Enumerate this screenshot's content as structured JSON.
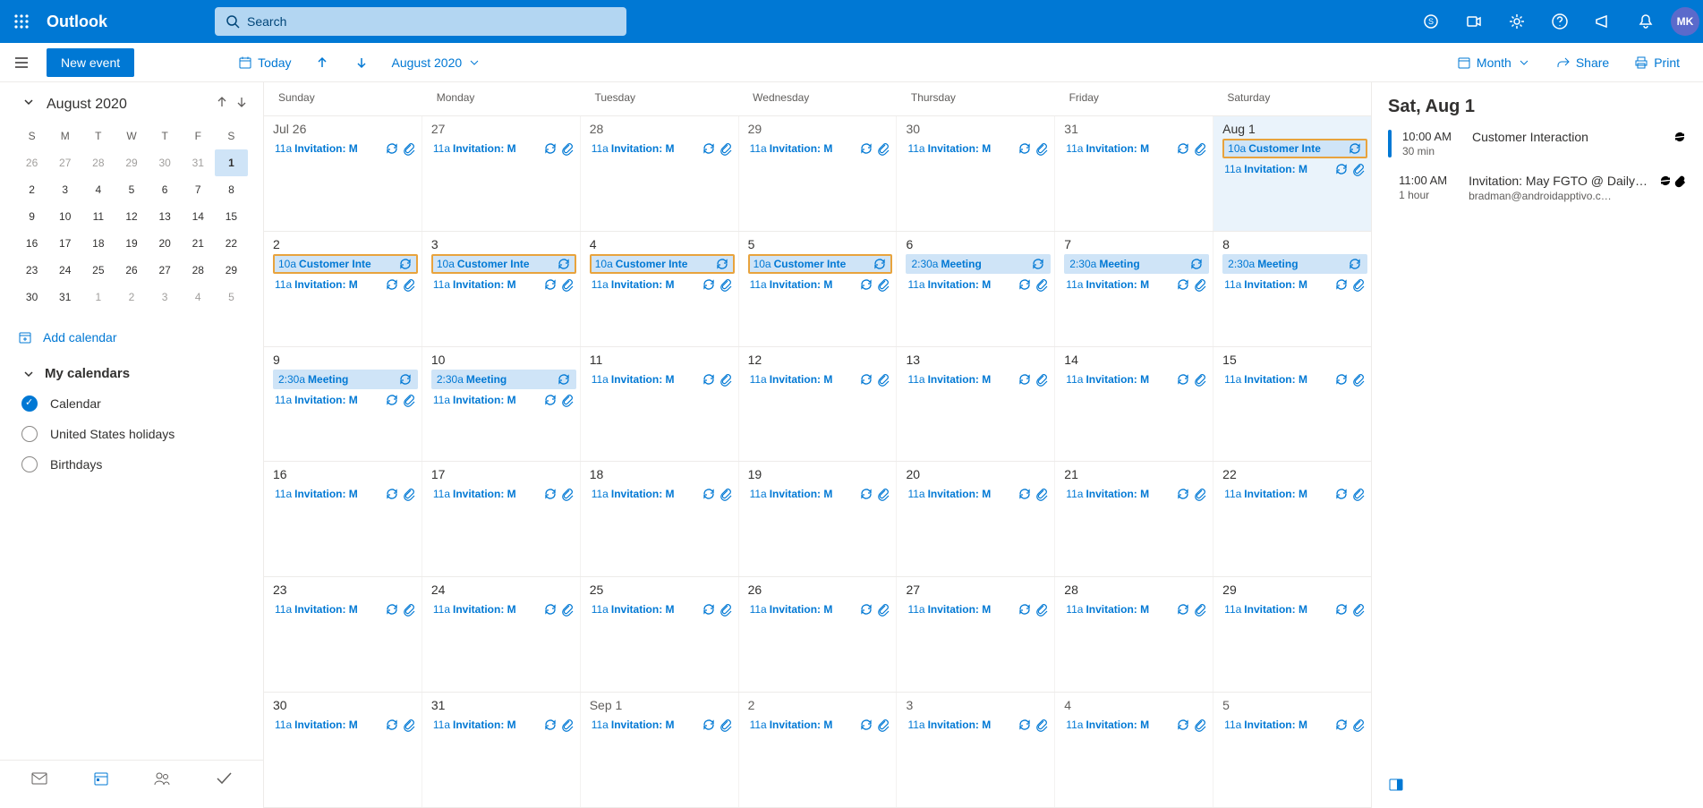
{
  "header": {
    "brand": "Outlook",
    "search_placeholder": "Search",
    "avatar_initials": "MK"
  },
  "toolbar": {
    "new_event": "New event",
    "today": "Today",
    "month_label": "August 2020",
    "view_label": "Month",
    "share": "Share",
    "print": "Print"
  },
  "miniCal": {
    "title": "August 2020",
    "dows": [
      "S",
      "M",
      "T",
      "W",
      "T",
      "F",
      "S"
    ],
    "rows": [
      [
        {
          "n": "26",
          "o": true
        },
        {
          "n": "27",
          "o": true
        },
        {
          "n": "28",
          "o": true
        },
        {
          "n": "29",
          "o": true
        },
        {
          "n": "30",
          "o": true
        },
        {
          "n": "31",
          "o": true
        },
        {
          "n": "1",
          "sel": true
        }
      ],
      [
        {
          "n": "2"
        },
        {
          "n": "3"
        },
        {
          "n": "4"
        },
        {
          "n": "5"
        },
        {
          "n": "6"
        },
        {
          "n": "7"
        },
        {
          "n": "8"
        }
      ],
      [
        {
          "n": "9"
        },
        {
          "n": "10"
        },
        {
          "n": "11"
        },
        {
          "n": "12"
        },
        {
          "n": "13"
        },
        {
          "n": "14"
        },
        {
          "n": "15"
        }
      ],
      [
        {
          "n": "16"
        },
        {
          "n": "17"
        },
        {
          "n": "18"
        },
        {
          "n": "19"
        },
        {
          "n": "20"
        },
        {
          "n": "21"
        },
        {
          "n": "22"
        }
      ],
      [
        {
          "n": "23"
        },
        {
          "n": "24"
        },
        {
          "n": "25"
        },
        {
          "n": "26"
        },
        {
          "n": "27"
        },
        {
          "n": "28"
        },
        {
          "n": "29"
        }
      ],
      [
        {
          "n": "30"
        },
        {
          "n": "31"
        },
        {
          "n": "1",
          "o": true
        },
        {
          "n": "2",
          "o": true
        },
        {
          "n": "3",
          "o": true
        },
        {
          "n": "4",
          "o": true
        },
        {
          "n": "5",
          "o": true
        }
      ]
    ]
  },
  "sidebar": {
    "add_calendar": "Add calendar",
    "my_calendars": "My calendars",
    "calendars": [
      {
        "name": "Calendar",
        "on": true
      },
      {
        "name": "United States holidays",
        "on": false
      },
      {
        "name": "Birthdays",
        "on": false
      }
    ]
  },
  "grid": {
    "dows": [
      "Sunday",
      "Monday",
      "Tuesday",
      "Wednesday",
      "Thursday",
      "Friday",
      "Saturday"
    ],
    "weeks": [
      [
        {
          "label": "Jul 26",
          "out": true,
          "events": [
            {
              "t": "11a",
              "title": "Invitation: M",
              "rec": true,
              "att": true
            }
          ]
        },
        {
          "label": "27",
          "out": true,
          "events": [
            {
              "t": "11a",
              "title": "Invitation: M",
              "rec": true,
              "att": true
            }
          ]
        },
        {
          "label": "28",
          "out": true,
          "events": [
            {
              "t": "11a",
              "title": "Invitation: M",
              "rec": true,
              "att": true
            }
          ]
        },
        {
          "label": "29",
          "out": true,
          "events": [
            {
              "t": "11a",
              "title": "Invitation: M",
              "rec": true,
              "att": true
            }
          ]
        },
        {
          "label": "30",
          "out": true,
          "events": [
            {
              "t": "11a",
              "title": "Invitation: M",
              "rec": true,
              "att": true
            }
          ]
        },
        {
          "label": "31",
          "out": true,
          "events": [
            {
              "t": "11a",
              "title": "Invitation: M",
              "rec": true,
              "att": true
            }
          ]
        },
        {
          "label": "Aug 1",
          "today": true,
          "events": [
            {
              "t": "10a",
              "title": "Customer Inte",
              "rec": true,
              "boxed": true
            },
            {
              "t": "11a",
              "title": "Invitation: M",
              "rec": true,
              "att": true
            }
          ]
        }
      ],
      [
        {
          "label": "2",
          "events": [
            {
              "t": "10a",
              "title": "Customer Inte",
              "rec": true,
              "boxed": true
            },
            {
              "t": "11a",
              "title": "Invitation: M",
              "rec": true,
              "att": true
            }
          ]
        },
        {
          "label": "3",
          "events": [
            {
              "t": "10a",
              "title": "Customer Inte",
              "rec": true,
              "boxed": true
            },
            {
              "t": "11a",
              "title": "Invitation: M",
              "rec": true,
              "att": true
            }
          ]
        },
        {
          "label": "4",
          "events": [
            {
              "t": "10a",
              "title": "Customer Inte",
              "rec": true,
              "boxed": true
            },
            {
              "t": "11a",
              "title": "Invitation: M",
              "rec": true,
              "att": true
            }
          ]
        },
        {
          "label": "5",
          "events": [
            {
              "t": "10a",
              "title": "Customer Inte",
              "rec": true,
              "boxed": true
            },
            {
              "t": "11a",
              "title": "Invitation: M",
              "rec": true,
              "att": true
            }
          ]
        },
        {
          "label": "6",
          "events": [
            {
              "t": "2:30a",
              "title": "Meeting",
              "rec": true,
              "filled": true
            },
            {
              "t": "11a",
              "title": "Invitation: M",
              "rec": true,
              "att": true
            }
          ]
        },
        {
          "label": "7",
          "events": [
            {
              "t": "2:30a",
              "title": "Meeting",
              "rec": true,
              "filled": true
            },
            {
              "t": "11a",
              "title": "Invitation: M",
              "rec": true,
              "att": true
            }
          ]
        },
        {
          "label": "8",
          "events": [
            {
              "t": "2:30a",
              "title": "Meeting",
              "rec": true,
              "filled": true
            },
            {
              "t": "11a",
              "title": "Invitation: M",
              "rec": true,
              "att": true
            }
          ]
        }
      ],
      [
        {
          "label": "9",
          "events": [
            {
              "t": "2:30a",
              "title": "Meeting",
              "rec": true,
              "filled": true
            },
            {
              "t": "11a",
              "title": "Invitation: M",
              "rec": true,
              "att": true
            }
          ]
        },
        {
          "label": "10",
          "events": [
            {
              "t": "2:30a",
              "title": "Meeting",
              "rec": true,
              "filled": true
            },
            {
              "t": "11a",
              "title": "Invitation: M",
              "rec": true,
              "att": true
            }
          ]
        },
        {
          "label": "11",
          "events": [
            {
              "t": "11a",
              "title": "Invitation: M",
              "rec": true,
              "att": true
            }
          ]
        },
        {
          "label": "12",
          "events": [
            {
              "t": "11a",
              "title": "Invitation: M",
              "rec": true,
              "att": true
            }
          ]
        },
        {
          "label": "13",
          "events": [
            {
              "t": "11a",
              "title": "Invitation: M",
              "rec": true,
              "att": true
            }
          ]
        },
        {
          "label": "14",
          "events": [
            {
              "t": "11a",
              "title": "Invitation: M",
              "rec": true,
              "att": true
            }
          ]
        },
        {
          "label": "15",
          "events": [
            {
              "t": "11a",
              "title": "Invitation: M",
              "rec": true,
              "att": true
            }
          ]
        }
      ],
      [
        {
          "label": "16",
          "events": [
            {
              "t": "11a",
              "title": "Invitation: M",
              "rec": true,
              "att": true
            }
          ]
        },
        {
          "label": "17",
          "events": [
            {
              "t": "11a",
              "title": "Invitation: M",
              "rec": true,
              "att": true
            }
          ]
        },
        {
          "label": "18",
          "events": [
            {
              "t": "11a",
              "title": "Invitation: M",
              "rec": true,
              "att": true
            }
          ]
        },
        {
          "label": "19",
          "events": [
            {
              "t": "11a",
              "title": "Invitation: M",
              "rec": true,
              "att": true
            }
          ]
        },
        {
          "label": "20",
          "events": [
            {
              "t": "11a",
              "title": "Invitation: M",
              "rec": true,
              "att": true
            }
          ]
        },
        {
          "label": "21",
          "events": [
            {
              "t": "11a",
              "title": "Invitation: M",
              "rec": true,
              "att": true
            }
          ]
        },
        {
          "label": "22",
          "events": [
            {
              "t": "11a",
              "title": "Invitation: M",
              "rec": true,
              "att": true
            }
          ]
        }
      ],
      [
        {
          "label": "23",
          "events": [
            {
              "t": "11a",
              "title": "Invitation: M",
              "rec": true,
              "att": true
            }
          ]
        },
        {
          "label": "24",
          "events": [
            {
              "t": "11a",
              "title": "Invitation: M",
              "rec": true,
              "att": true
            }
          ]
        },
        {
          "label": "25",
          "events": [
            {
              "t": "11a",
              "title": "Invitation: M",
              "rec": true,
              "att": true
            }
          ]
        },
        {
          "label": "26",
          "events": [
            {
              "t": "11a",
              "title": "Invitation: M",
              "rec": true,
              "att": true
            }
          ]
        },
        {
          "label": "27",
          "events": [
            {
              "t": "11a",
              "title": "Invitation: M",
              "rec": true,
              "att": true
            }
          ]
        },
        {
          "label": "28",
          "events": [
            {
              "t": "11a",
              "title": "Invitation: M",
              "rec": true,
              "att": true
            }
          ]
        },
        {
          "label": "29",
          "events": [
            {
              "t": "11a",
              "title": "Invitation: M",
              "rec": true,
              "att": true
            }
          ]
        }
      ],
      [
        {
          "label": "30",
          "events": [
            {
              "t": "11a",
              "title": "Invitation: M",
              "rec": true,
              "att": true
            }
          ]
        },
        {
          "label": "31",
          "events": [
            {
              "t": "11a",
              "title": "Invitation: M",
              "rec": true,
              "att": true
            }
          ]
        },
        {
          "label": "Sep 1",
          "out": true,
          "events": [
            {
              "t": "11a",
              "title": "Invitation: M",
              "rec": true,
              "att": true
            }
          ]
        },
        {
          "label": "2",
          "out": true,
          "events": [
            {
              "t": "11a",
              "title": "Invitation: M",
              "rec": true,
              "att": true
            }
          ]
        },
        {
          "label": "3",
          "out": true,
          "events": [
            {
              "t": "11a",
              "title": "Invitation: M",
              "rec": true,
              "att": true
            }
          ]
        },
        {
          "label": "4",
          "out": true,
          "events": [
            {
              "t": "11a",
              "title": "Invitation: M",
              "rec": true,
              "att": true
            }
          ]
        },
        {
          "label": "5",
          "out": true,
          "events": [
            {
              "t": "11a",
              "title": "Invitation: M",
              "rec": true,
              "att": true
            }
          ]
        }
      ]
    ]
  },
  "agenda": {
    "date": "Sat, Aug 1",
    "items": [
      {
        "time": "10:00 AM",
        "dur": "30 min",
        "title": "Customer Interaction",
        "sub": "",
        "rec": true,
        "bar": "solid"
      },
      {
        "time": "11:00 AM",
        "dur": "1 hour",
        "title": "Invitation: May FGTO @ Daily…",
        "sub": "bradman@androidapptivo.c…",
        "rec": true,
        "att": true,
        "bar": "stripe"
      }
    ]
  }
}
